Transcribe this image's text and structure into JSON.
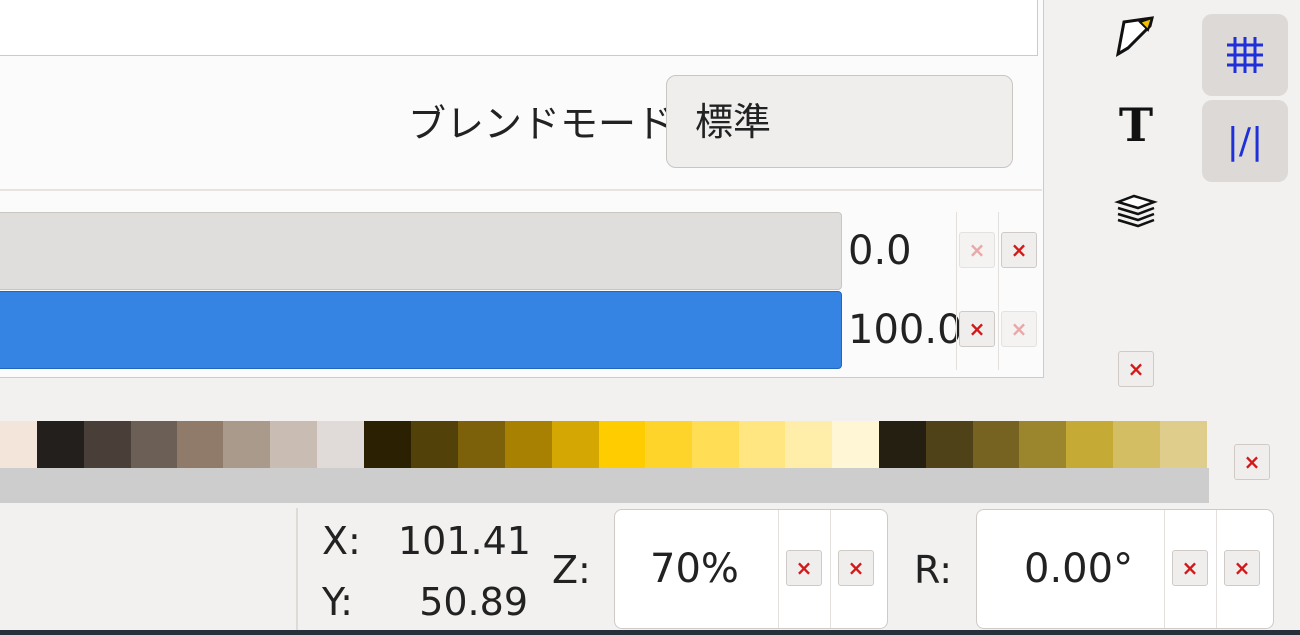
{
  "blend": {
    "label": "ブレンドモード:",
    "value": "標準"
  },
  "sliders": [
    {
      "value": "0.0"
    },
    {
      "value": "100.0"
    }
  ],
  "palette": {
    "colors": [
      "#f3e5da",
      "#231f1c",
      "#4a3f38",
      "#6c5f55",
      "#907a6a",
      "#aa9a8c",
      "#c9bcb3",
      "#e0dbd8",
      "#2b2102",
      "#53410a",
      "#7c610a",
      "#a88103",
      "#d5a703",
      "#ffcc00",
      "#ffd42a",
      "#ffdd55",
      "#ffe680",
      "#ffeeaa",
      "#fff6d5",
      "#241f11",
      "#4f4118",
      "#766221",
      "#9b852d",
      "#c5aa36",
      "#d4be64",
      "#dfcd8b"
    ]
  },
  "status": {
    "x_label": "X:",
    "x_value": "101.41",
    "y_label": "Y:",
    "y_value": "50.89",
    "zoom_label": "Z:",
    "zoom_value": "70%",
    "rotate_label": "R:",
    "rotate_value": "0.00°"
  },
  "icons": {
    "x": "×",
    "guide": "|/|"
  },
  "colors": {
    "accent": "#3584e4",
    "delete": "#d21919"
  }
}
